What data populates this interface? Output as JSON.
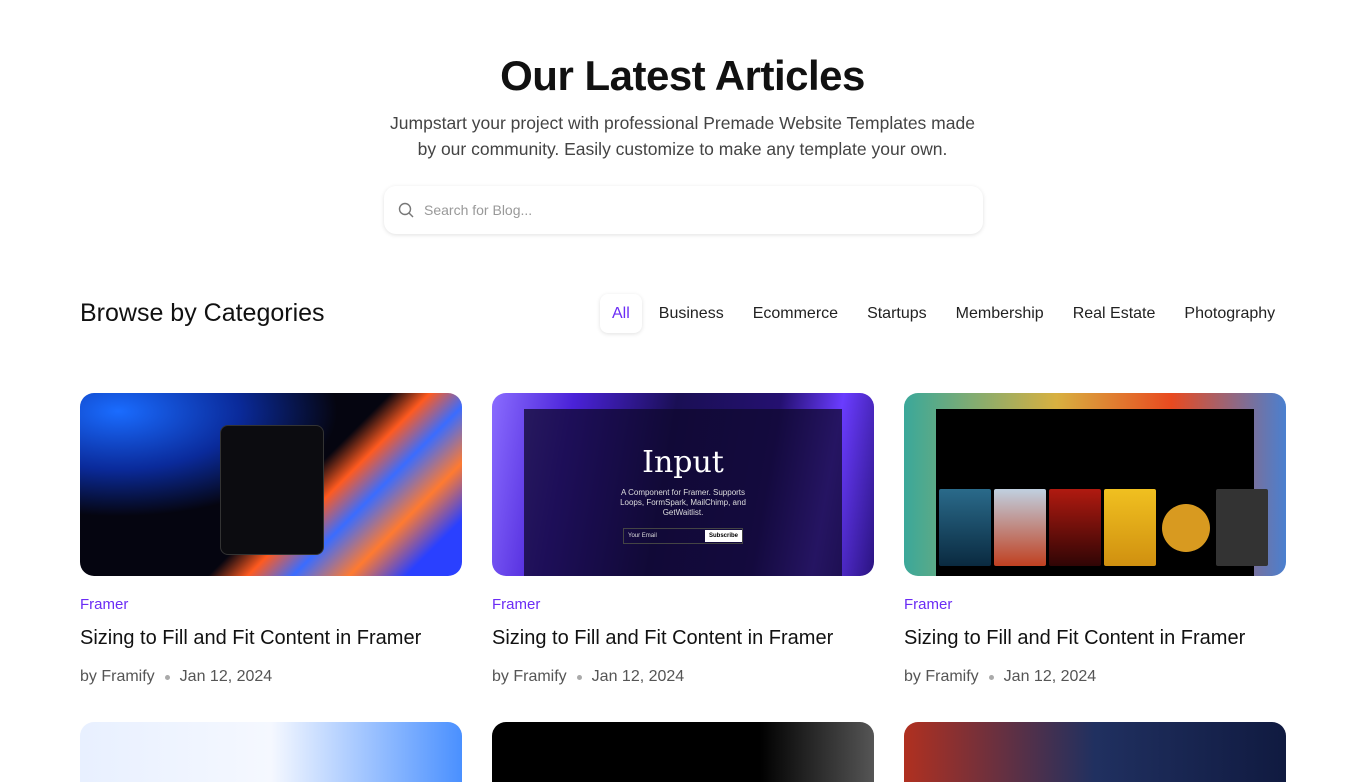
{
  "header": {
    "title": "Our Latest Articles",
    "subtitle_line1": "Jumpstart your project with professional Premade Website Templates made",
    "subtitle_line2": "by our community. Easily customize to make any template your own."
  },
  "search": {
    "placeholder": "Search for Blog...",
    "value": "",
    "icon": "search-icon"
  },
  "categories": {
    "heading": "Browse by Categories",
    "tabs": [
      "All",
      "Business",
      "Ecommerce",
      "Startups",
      "Membership",
      "Real Estate",
      "Photography"
    ],
    "active": "All"
  },
  "accent": "#6b2cf5",
  "cards": [
    {
      "category": "Framer",
      "title": "Sizing to Fill and Fit Content in Framer",
      "author": "by Framify",
      "date": "Jan 12, 2024"
    },
    {
      "category": "Framer",
      "title": "Sizing to Fill and Fit Content in Framer",
      "author": "by Framify",
      "date": "Jan 12, 2024",
      "thumb": {
        "heading": "Input",
        "desc": "A Component for Framer. Supports Loops, FormSpark, MailChimp, and GetWaitlist.",
        "email": "Your Email",
        "button": "Subscribe"
      }
    },
    {
      "category": "Framer",
      "title": "Sizing to Fill and Fit Content in Framer",
      "author": "by Framify",
      "date": "Jan 12, 2024"
    }
  ]
}
